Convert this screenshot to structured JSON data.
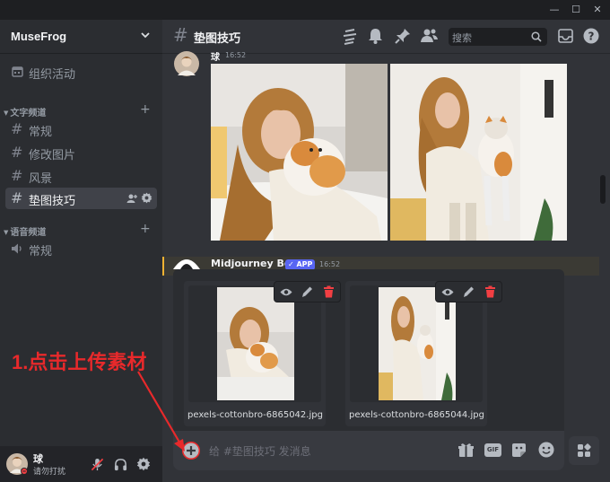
{
  "window": {
    "controls": [
      "—",
      "☐",
      "✕"
    ]
  },
  "server": {
    "name": "MuseFrog",
    "events_label": "组织活动"
  },
  "categories": {
    "text": "文字频道",
    "voice": "语音频道"
  },
  "text_channels": [
    "常规",
    "修改图片",
    "风景",
    "垫图技巧"
  ],
  "voice_channels": [
    "常规"
  ],
  "header": {
    "channel": "垫图技巧",
    "search_placeholder": "搜索"
  },
  "messages": [
    {
      "author": "球",
      "time": "16:52"
    },
    {
      "author": "Midjourney Bot",
      "badge": "✓ APP",
      "time": "16:52"
    }
  ],
  "attachments": [
    {
      "filename": "pexels-cottonbro-6865042.jpg"
    },
    {
      "filename": "pexels-cottonbro-6865044.jpg"
    }
  ],
  "composer": {
    "placeholder": "给 #垫图技巧 发消息",
    "gif_label": "GIF"
  },
  "user": {
    "name": "球",
    "status": "请勿打扰"
  },
  "annotation": "1.点击上传素材",
  "colors": {
    "accent": "#5865f2",
    "annotation_red": "#e8292b",
    "dnd": "#f23f43",
    "highlight": "#f0b232"
  },
  "icons": [
    "events-icon",
    "hash-icon",
    "threads-icon",
    "bell-icon",
    "pin-icon",
    "members-icon",
    "search-icon",
    "inbox-icon",
    "help-icon",
    "eye-icon",
    "pencil-icon",
    "trash-icon",
    "plus-icon",
    "gift-icon",
    "sticker-icon",
    "emoji-icon",
    "apps-icon",
    "mute-mic-icon",
    "headphones-icon",
    "gear-icon",
    "speaker-icon"
  ]
}
